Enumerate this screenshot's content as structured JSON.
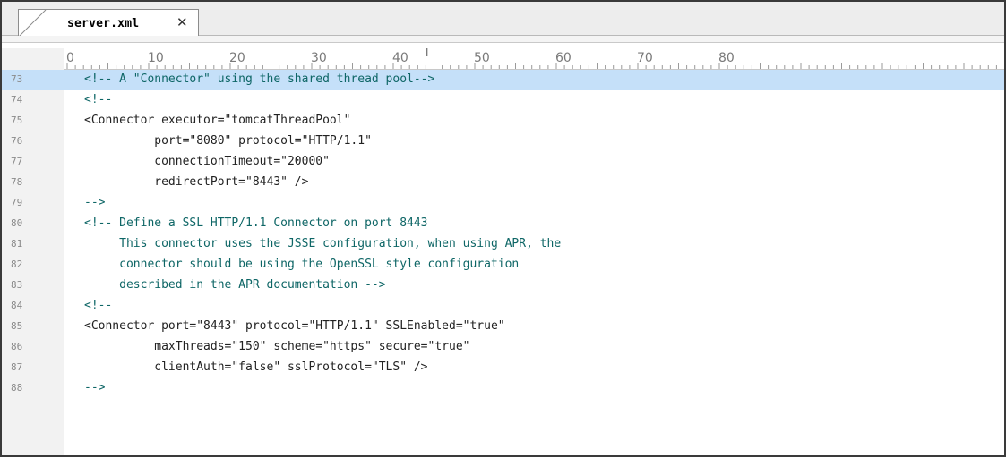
{
  "tab": {
    "title": "server.xml",
    "close_glyph": "✕"
  },
  "ruler": {
    "labels": [
      "0",
      "10",
      "20",
      "30",
      "40",
      "50",
      "60",
      "70",
      "80"
    ],
    "caret_mark": "T"
  },
  "editor": {
    "current_line": 73,
    "lines": [
      {
        "num": "73",
        "text": "<!-- A \"Connector\" using the shared thread pool-->",
        "kind": "comment"
      },
      {
        "num": "74",
        "text": "<!--",
        "kind": "comment"
      },
      {
        "num": "75",
        "text": "<Connector executor=\"tomcatThreadPool\"",
        "kind": "tag"
      },
      {
        "num": "76",
        "text": "          port=\"8080\" protocol=\"HTTP/1.1\"",
        "kind": "tag"
      },
      {
        "num": "77",
        "text": "          connectionTimeout=\"20000\"",
        "kind": "tag"
      },
      {
        "num": "78",
        "text": "          redirectPort=\"8443\" />",
        "kind": "tag"
      },
      {
        "num": "79",
        "text": "-->",
        "kind": "comment"
      },
      {
        "num": "80",
        "text": "<!-- Define a SSL HTTP/1.1 Connector on port 8443",
        "kind": "comment"
      },
      {
        "num": "81",
        "text": "     This connector uses the JSSE configuration, when using APR, the",
        "kind": "comment"
      },
      {
        "num": "82",
        "text": "     connector should be using the OpenSSL style configuration",
        "kind": "comment"
      },
      {
        "num": "83",
        "text": "     described in the APR documentation -->",
        "kind": "comment"
      },
      {
        "num": "84",
        "text": "<!--",
        "kind": "comment"
      },
      {
        "num": "85",
        "text": "<Connector port=\"8443\" protocol=\"HTTP/1.1\" SSLEnabled=\"true\"",
        "kind": "tag"
      },
      {
        "num": "86",
        "text": "          maxThreads=\"150\" scheme=\"https\" secure=\"true\"",
        "kind": "tag"
      },
      {
        "num": "87",
        "text": "          clientAuth=\"false\" sslProtocol=\"TLS\" />",
        "kind": "tag"
      },
      {
        "num": "88",
        "text": "-->",
        "kind": "comment"
      }
    ]
  },
  "colors": {
    "comment": "#0e6666",
    "highlight": "#c5e0f9",
    "gutter": "#f2f2f2"
  }
}
